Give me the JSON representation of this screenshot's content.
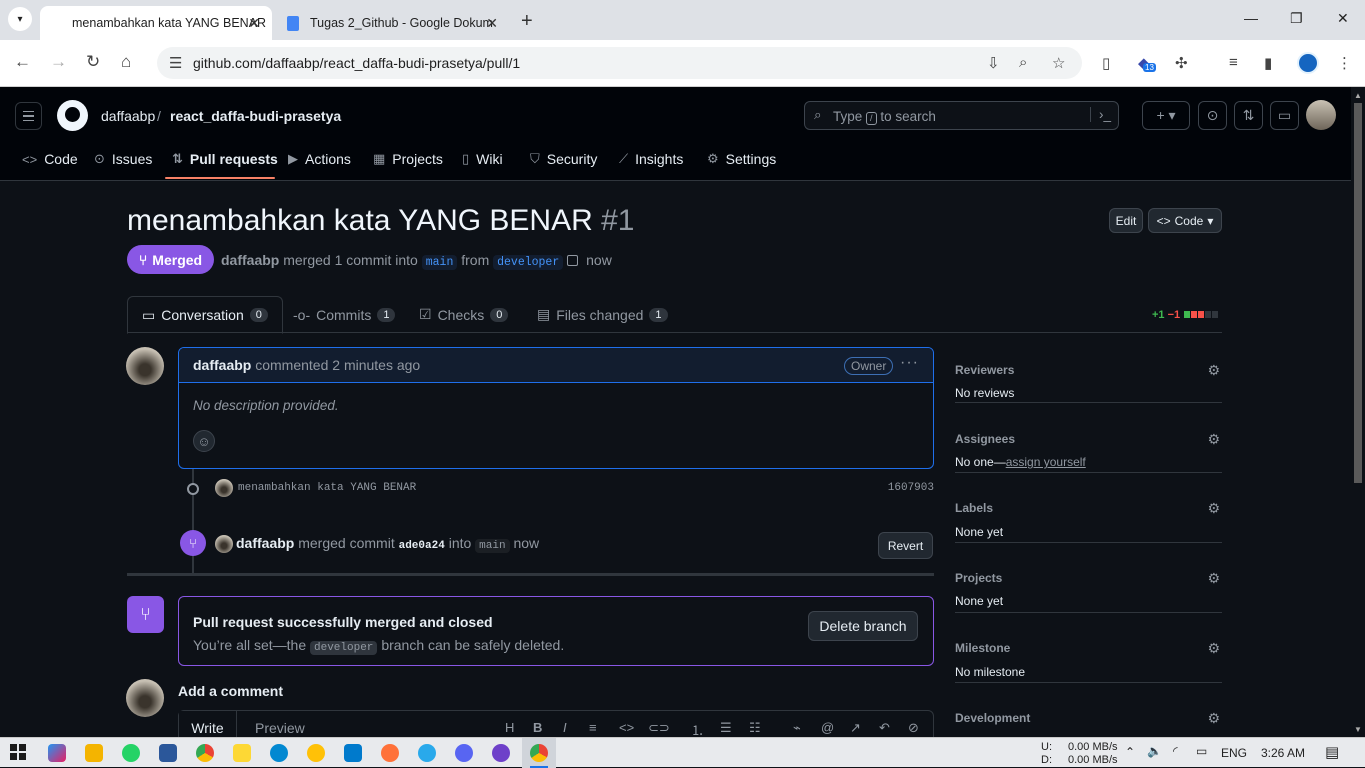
{
  "browser": {
    "tabs": [
      {
        "title": "menambahkan kata YANG BENAR",
        "active": true
      },
      {
        "title": "Tugas 2_Github - Google Dokum",
        "active": false
      }
    ],
    "url": "github.com/daffaabp/react_daffa-budi-prasetya/pull/1",
    "extension_badge": "13"
  },
  "github": {
    "owner": "daffaabp",
    "separator": "/",
    "repo": "react_daffa-budi-prasetya",
    "search_prefix": "Type",
    "search_key": "/",
    "search_suffix": "to search",
    "nav": [
      "Code",
      "Issues",
      "Pull requests",
      "Actions",
      "Projects",
      "Wiki",
      "Security",
      "Insights",
      "Settings"
    ]
  },
  "pr": {
    "title": "menambahkan kata YANG BENAR",
    "number": "#1",
    "edit_label": "Edit",
    "code_label": "Code",
    "state": "Merged",
    "author": "daffaabp",
    "merged_text": "merged 1 commit into",
    "base_branch": "main",
    "from_text": "from",
    "head_branch": "developer",
    "time": "now",
    "tabs": [
      {
        "label": "Conversation",
        "count": "0"
      },
      {
        "label": "Commits",
        "count": "1"
      },
      {
        "label": "Checks",
        "count": "0"
      },
      {
        "label": "Files changed",
        "count": "1"
      }
    ],
    "diff_add": "+1",
    "diff_del": "−1",
    "diff_colors": [
      "#3fb950",
      "#f85149",
      "#f85149",
      "#30363d",
      "#30363d"
    ]
  },
  "comment": {
    "author": "daffaabp",
    "action": "commented 2 minutes ago",
    "role": "Owner",
    "body": "No description provided."
  },
  "commit": {
    "message": "menambahkan kata YANG BENAR",
    "sha": "1607903"
  },
  "merge_event": {
    "author": "daffaabp",
    "text1": "merged commit",
    "sha": "ade0a24",
    "text2": "into",
    "branch": "main",
    "time": "now",
    "revert_label": "Revert"
  },
  "merged_box": {
    "title": "Pull request successfully merged and closed",
    "text1": "You’re all set—the",
    "branch": "developer",
    "text2": "branch can be safely deleted.",
    "button": "Delete branch"
  },
  "add_comment": {
    "heading": "Add a comment",
    "write_tab": "Write",
    "preview_tab": "Preview"
  },
  "sidebar": {
    "reviewers_h": "Reviewers",
    "reviewers_v": "No reviews",
    "assignees_h": "Assignees",
    "assignees_v": "No one—",
    "assignees_link": "assign yourself",
    "labels_h": "Labels",
    "labels_v": "None yet",
    "projects_h": "Projects",
    "projects_v": "None yet",
    "milestone_h": "Milestone",
    "milestone_v": "No milestone",
    "development_h": "Development"
  },
  "taskbar": {
    "upload": "U:",
    "upload_speed": "0.00 MB/s",
    "download": "D:",
    "download_speed": "0.00 MB/s",
    "language": "ENG",
    "clock": "3:26 AM"
  }
}
